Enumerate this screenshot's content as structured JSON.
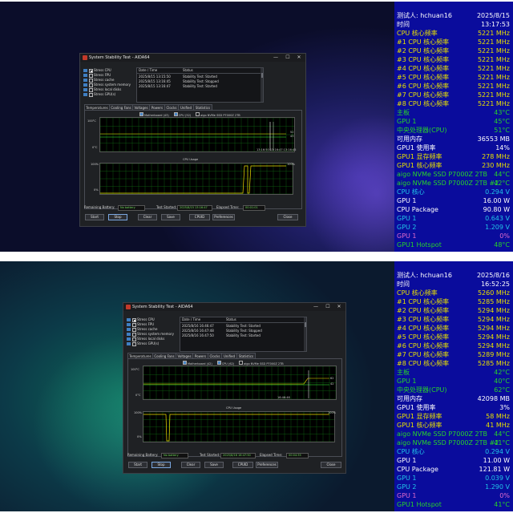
{
  "colors": {
    "osd_bg": "#0a0c9c",
    "osd_yellow": "#e8e000",
    "osd_green": "#27d32a",
    "osd_cyan": "#21c4e8",
    "osd_white": "#ffffff",
    "osd_pink": "#e06acb",
    "chart_green": "#35ff35",
    "chart_yellow": "#f0e000"
  },
  "panels": [
    {
      "window": {
        "title": "System Stability Test - AIDA64",
        "controls": [
          "—",
          "☐",
          "✕"
        ],
        "stress_items": [
          {
            "label": "Stress CPU",
            "checked": true,
            "icon": "cpu-icon"
          },
          {
            "label": "Stress FPU",
            "checked": false,
            "icon": "fpu-icon"
          },
          {
            "label": "Stress cache",
            "checked": false,
            "icon": "cache-icon"
          },
          {
            "label": "Stress system memory",
            "checked": false,
            "icon": "memory-icon"
          },
          {
            "label": "Stress local disks",
            "checked": false,
            "icon": "disk-icon"
          },
          {
            "label": "Stress GPU(s)",
            "checked": false,
            "icon": "gpu-icon"
          }
        ],
        "log_headers": [
          "Date / Time",
          "Status"
        ],
        "log_rows": [
          [
            "2025/8/15 13:15:50",
            "Stability Test: Started"
          ],
          [
            "2025/8/15 13:16:45",
            "Stability Test: Stopped"
          ],
          [
            "2025/8/15 13:16:47",
            "Stability Test: Started"
          ]
        ],
        "tabs": [
          "Temperatures",
          "Cooling Fans",
          "Voltages",
          "Powers",
          "Clocks",
          "Unified",
          "Statistics"
        ],
        "active_tab": 0,
        "temp_legend": [
          {
            "label": "Motherboard (43)",
            "checked": true
          },
          {
            "label": "CPU (52)",
            "checked": true
          },
          {
            "label": "aigo NVMe SSD P7000Z 2TB",
            "checked": false
          }
        ],
        "temp_y_top": "100°C",
        "temp_y_bottom": "0°C",
        "temp_time_label": "13:16:50 13:16:47:13:16:45",
        "temp_right_values": [
          "52",
          "43"
        ],
        "cpu_title": "CPU Usage",
        "cpu_y_top": "100%",
        "cpu_y_bottom": "0%",
        "cpu_right_value": "100%",
        "battery_label": "Remaining Battery:",
        "battery_value": "No battery",
        "test_started_label": "Test Started:",
        "test_started_value": "2025/8/15 13:16:47",
        "elapsed_label": "Elapsed Time:",
        "elapsed_value": "00:01:01",
        "buttons": [
          "Start",
          "Stop",
          "Clear",
          "Save",
          "CPUID",
          "Preferences",
          "Close"
        ]
      },
      "sensors": [
        {
          "label": "测试人:  hchuan16",
          "value": "2025/8/15",
          "color": "white"
        },
        {
          "label": "时间",
          "value": "13:17:53",
          "color": "white"
        },
        {
          "label": "CPU 核心频率",
          "value": "5221 MHz",
          "color": "yellow"
        },
        {
          "label": "#1 CPU 核心频率",
          "value": "5221 MHz",
          "color": "yellow"
        },
        {
          "label": "#2 CPU 核心频率",
          "value": "5221 MHz",
          "color": "yellow"
        },
        {
          "label": "#3 CPU 核心频率",
          "value": "5221 MHz",
          "color": "yellow"
        },
        {
          "label": "#4 CPU 核心频率",
          "value": "5221 MHz",
          "color": "yellow"
        },
        {
          "label": "#5 CPU 核心频率",
          "value": "5221 MHz",
          "color": "yellow"
        },
        {
          "label": "#6 CPU 核心频率",
          "value": "5221 MHz",
          "color": "yellow"
        },
        {
          "label": "#7 CPU 核心频率",
          "value": "5221 MHz",
          "color": "yellow"
        },
        {
          "label": "#8 CPU 核心频率",
          "value": "5221 MHz",
          "color": "yellow"
        },
        {
          "label": "主板",
          "value": "43°C",
          "color": "green"
        },
        {
          "label": "GPU 1",
          "value": "45°C",
          "color": "green"
        },
        {
          "label": "中央处理器(CPU)",
          "value": "51°C",
          "color": "green"
        },
        {
          "label": "可用内存",
          "value": "36553 MB",
          "color": "white"
        },
        {
          "label": "GPU1 使用率",
          "value": "14%",
          "color": "white"
        },
        {
          "label": "GPU1 显存频率",
          "value": "278 MHz",
          "color": "yellow"
        },
        {
          "label": "GPU1 核心频率",
          "value": "230 MHz",
          "color": "yellow"
        },
        {
          "label": "aigo NVMe SSD P7000Z 2TB",
          "value": "44°C",
          "color": "green"
        },
        {
          "label": "aigo NVMe SSD P7000Z 2TB #2",
          "value": "42°C",
          "color": "green"
        },
        {
          "label": "CPU 核心",
          "value": "0.294 V",
          "color": "cyan"
        },
        {
          "label": "GPU 1",
          "value": "16.00 W",
          "color": "white"
        },
        {
          "label": "CPU Package",
          "value": "90.80 W",
          "color": "white"
        },
        {
          "label": "GPU 1",
          "value": "0.643 V",
          "color": "cyan"
        },
        {
          "label": "GPU 2",
          "value": "1.209 V",
          "color": "cyan"
        },
        {
          "label": "GPU 1",
          "value": "0%",
          "color": "pink"
        },
        {
          "label": "GPU1 Hotspot",
          "value": "48°C",
          "color": "green"
        }
      ]
    },
    {
      "window": {
        "title": "System Stability Test - AIDA64",
        "controls": [
          "—",
          "☐",
          "✕"
        ],
        "stress_items": [
          {
            "label": "Stress CPU",
            "checked": true,
            "icon": "cpu-icon"
          },
          {
            "label": "Stress FPU",
            "checked": false,
            "icon": "fpu-icon"
          },
          {
            "label": "Stress cache",
            "checked": false,
            "icon": "cache-icon"
          },
          {
            "label": "Stress system memory",
            "checked": false,
            "icon": "memory-icon"
          },
          {
            "label": "Stress local disks",
            "checked": false,
            "icon": "disk-icon"
          },
          {
            "label": "Stress GPU(s)",
            "checked": false,
            "icon": "gpu-icon"
          }
        ],
        "log_headers": [
          "Date / Time",
          "Status"
        ],
        "log_rows": [
          [
            "2025/8/16 16:46:47",
            "Stability Test: Started"
          ],
          [
            "2025/8/16 16:47:48",
            "Stability Test: Stopped"
          ],
          [
            "2025/8/16 16:47:50",
            "Stability Test: Started"
          ]
        ],
        "tabs": [
          "Temperatures",
          "Cooling Fans",
          "Voltages",
          "Powers",
          "Clocks",
          "Unified",
          "Statistics"
        ],
        "active_tab": 0,
        "temp_legend": [
          {
            "label": "Motherboard (42)",
            "checked": true
          },
          {
            "label": "CPU (62)",
            "checked": true
          },
          {
            "label": "aigo NVMe SSD P7000Z 2TB",
            "checked": false
          }
        ],
        "temp_y_top": "100°C",
        "temp_y_bottom": "0°C",
        "temp_time_label": "16:46:46",
        "temp_right_values": [
          "62",
          "42"
        ],
        "cpu_title": "CPU Usage",
        "cpu_y_top": "100%",
        "cpu_y_bottom": "0%",
        "cpu_right_value": "100%",
        "battery_label": "Remaining Battery:",
        "battery_value": "No battery",
        "test_started_label": "Test Started:",
        "test_started_value": "2025/8/16 16:47:50",
        "elapsed_label": "Elapsed Time:",
        "elapsed_value": "00:04:35",
        "buttons": [
          "Start",
          "Stop",
          "Clear",
          "Save",
          "CPUID",
          "Preferences",
          "Close"
        ]
      },
      "sensors": [
        {
          "label": "测试人:  hchuan16",
          "value": "2025/8/16",
          "color": "white"
        },
        {
          "label": "时间",
          "value": "16:52:25",
          "color": "white"
        },
        {
          "label": "CPU 核心频率",
          "value": "5260 MHz",
          "color": "yellow"
        },
        {
          "label": "#1 CPU 核心频率",
          "value": "5285 MHz",
          "color": "yellow"
        },
        {
          "label": "#2 CPU 核心频率",
          "value": "5294 MHz",
          "color": "yellow"
        },
        {
          "label": "#3 CPU 核心频率",
          "value": "5294 MHz",
          "color": "yellow"
        },
        {
          "label": "#4 CPU 核心频率",
          "value": "5294 MHz",
          "color": "yellow"
        },
        {
          "label": "#5 CPU 核心频率",
          "value": "5294 MHz",
          "color": "yellow"
        },
        {
          "label": "#6 CPU 核心频率",
          "value": "5294 MHz",
          "color": "yellow"
        },
        {
          "label": "#7 CPU 核心频率",
          "value": "5289 MHz",
          "color": "yellow"
        },
        {
          "label": "#8 CPU 核心频率",
          "value": "5285 MHz",
          "color": "yellow"
        },
        {
          "label": "主板",
          "value": "42°C",
          "color": "green"
        },
        {
          "label": "GPU 1",
          "value": "40°C",
          "color": "green"
        },
        {
          "label": "中央处理器(CPU)",
          "value": "62°C",
          "color": "green"
        },
        {
          "label": "可用内存",
          "value": "42098 MB",
          "color": "white"
        },
        {
          "label": "GPU1 使用率",
          "value": "3%",
          "color": "white"
        },
        {
          "label": "GPU1 显存频率",
          "value": "58 MHz",
          "color": "yellow"
        },
        {
          "label": "GPU1 核心频率",
          "value": "41 MHz",
          "color": "yellow"
        },
        {
          "label": "aigo NVMe SSD P7000Z 2TB",
          "value": "44°C",
          "color": "green"
        },
        {
          "label": "aigo NVMe SSD P7000Z 2TB #2",
          "value": "41°C",
          "color": "green"
        },
        {
          "label": "CPU 核心",
          "value": "0.294 V",
          "color": "cyan"
        },
        {
          "label": "GPU 1",
          "value": "11.00 W",
          "color": "white"
        },
        {
          "label": "CPU Package",
          "value": "121.81 W",
          "color": "white"
        },
        {
          "label": "GPU 1",
          "value": "0.039 V",
          "color": "cyan"
        },
        {
          "label": "GPU 2",
          "value": "1.290 V",
          "color": "cyan"
        },
        {
          "label": "GPU 1",
          "value": "0%",
          "color": "pink"
        },
        {
          "label": "GPU1 Hotspot",
          "value": "41°C",
          "color": "green"
        }
      ]
    }
  ]
}
